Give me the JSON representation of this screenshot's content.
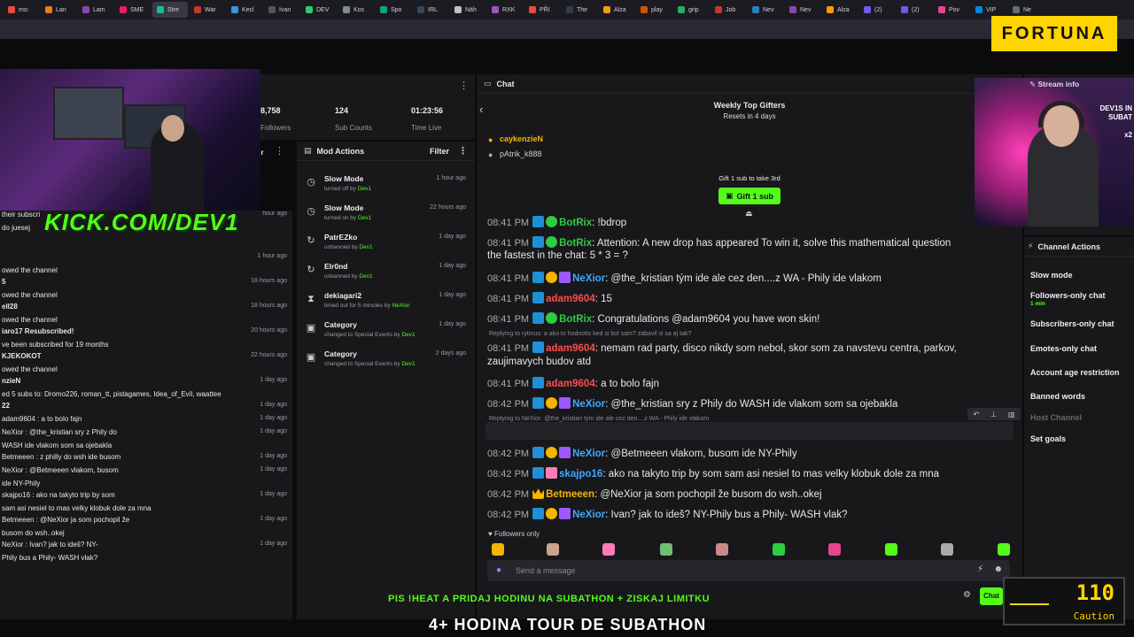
{
  "browser": {
    "tabs": [
      "mo:",
      "Lan",
      "Lam",
      "SME",
      "Stre",
      "War",
      "Kecl",
      "Ivan",
      "DEV",
      "Kos",
      "Spo",
      "IRL",
      "Náh",
      "RXK",
      "PŘI",
      "The",
      "Alza",
      "play",
      "grip",
      "Job",
      "Nev",
      "Nev",
      "Alza",
      "(2)",
      "(2)",
      "Pov",
      "VIP",
      "Ne"
    ]
  },
  "sponsor": "FORTUNA",
  "stream": {
    "overlay_logo": "KICK.COM/DEV1",
    "followers_value": "8,758",
    "followers_label": "Followers",
    "subs_value": "124",
    "subs_label": "Sub Counts",
    "time_value": "01:23:56",
    "time_label": "Time Live"
  },
  "left_feed": [
    {
      "text": "their subscri",
      "time": "hour ago"
    },
    {
      "text": "do juesej",
      "time": ""
    },
    {
      "text": "",
      "time": "1 hour ago"
    },
    {
      "text": "owed the channel",
      "time": ""
    },
    {
      "text": "5",
      "time": "18 hours ago"
    },
    {
      "text": "owed the channel",
      "time": ""
    },
    {
      "text": "ell28",
      "time": "18 hours ago"
    },
    {
      "text": "owed the channel",
      "time": ""
    },
    {
      "text": "iaro17 Resubscribed!",
      "time": "20 hours ago"
    },
    {
      "text": "ve been subscribed for 19 months",
      "time": ""
    },
    {
      "text": "KJEKOKOT",
      "time": "22 hours ago"
    },
    {
      "text": "owed the channel",
      "time": ""
    },
    {
      "text": "nzieN",
      "time": "1 day ago"
    },
    {
      "text": "ed 5 subs to: Dromo226, roman_tt, pistagames, Idea_of_Evil, waattee",
      "time": ""
    },
    {
      "text": "22",
      "time": "1 day ago"
    },
    {
      "text": "adam9604 : a to bolo fajn",
      "time": "1 day ago"
    },
    {
      "text": "NeXior : @the_kristian sry z Phily do",
      "time": "1 day ago"
    },
    {
      "text": "WASH ide vlakom  som sa ojebakla",
      "time": ""
    },
    {
      "text": "Betmeeen : z philly do wsh ide busom",
      "time": "1 day ago"
    },
    {
      "text": "NeXior : @Betmeeen vlakom, busom",
      "time": "1 day ago"
    },
    {
      "text": "ide NY-Phily",
      "time": ""
    },
    {
      "text": "skajpo16 : ako na takyto trip by som",
      "time": "1 day ago"
    },
    {
      "text": "sam asi nesiel to mas velky klobuk dole za mna",
      "time": ""
    },
    {
      "text": "Betmeeen : @NeXior ja som pochopil že",
      "time": "1 day ago"
    },
    {
      "text": "busom do wsh..okej",
      "time": ""
    },
    {
      "text": "NeXior : Ivan?  jak to ideš? NY-",
      "time": "1 day ago"
    },
    {
      "text": "Phily bus a Phily- WASH vlak?",
      "time": ""
    }
  ],
  "mod_actions": {
    "title": "Mod Actions",
    "filter": "Filter",
    "items": [
      {
        "title": "Slow Mode",
        "sub": "turned off by",
        "who": "Dev1",
        "time": "1 hour ago",
        "icon": "slow-mode-icon"
      },
      {
        "title": "Slow Mode",
        "sub": "turned on by",
        "who": "Dev1",
        "time": "22 hours ago",
        "icon": "slow-mode-icon"
      },
      {
        "title": "PatrEZko",
        "sub": "unbanned by",
        "who": "Dev1",
        "time": "1 day ago",
        "icon": "unban-icon"
      },
      {
        "title": "Elr0nd",
        "sub": "unbanned by",
        "who": "Dev1",
        "time": "1 day ago",
        "icon": "unban-icon"
      },
      {
        "title": "dekiagari2",
        "sub": "timed out for 5 minutes by",
        "who": "NeXior",
        "time": "1 day ago",
        "icon": "timeout-icon"
      },
      {
        "title": "Category",
        "sub": "changed to Special Events by",
        "who": "Dev1",
        "time": "1 day ago",
        "icon": "category-icon"
      },
      {
        "title": "Category",
        "sub": "changed to Special Events by",
        "who": "Dev1",
        "time": "2 days ago",
        "icon": "category-icon"
      }
    ]
  },
  "chat": {
    "title": "Chat",
    "gifters_title": "Weekly Top Gifters",
    "gifters_reset": "Resets in 4 days",
    "gifters": [
      "caykenzieN",
      "pAtrik_k888"
    ],
    "gift_prompt": "Gift 1 sub to take 3rd",
    "gift_button": "Gift 1 sub",
    "messages": [
      {
        "ts": "08:41 PM",
        "user": "BotRix",
        "color": "#2ecc40",
        "text": ": !bdrop"
      },
      {
        "ts": "08:41 PM",
        "user": "BotRix",
        "color": "#2ecc40",
        "text": ": Attention: A new drop has appeared  To win it, solve this mathematical question"
      },
      {
        "ts": "",
        "user": "",
        "color": "",
        "text": "the fastest in the chat: 5 * 3 = ?"
      },
      {
        "ts": "08:41 PM",
        "user": "NeXior",
        "color": "#3fa9ff",
        "text": ": @the_kristian tým ide ale cez den....z WA - Phily ide vlakom"
      },
      {
        "ts": "08:41 PM",
        "user": "adam9604",
        "color": "#ff4b4b",
        "text": ": 15"
      },
      {
        "ts": "08:41 PM",
        "user": "BotRix",
        "color": "#2ecc40",
        "text": ": Congratulations @adam9604 you have won skin!"
      },
      {
        "ts": "08:41 PM",
        "user": "adam9604",
        "color": "#ff4b4b",
        "text": ": nemam rad party, disco nikdy som nebol, skor som za navstevu centra, parkov,"
      },
      {
        "ts": "",
        "user": "",
        "color": "",
        "text": "zaujimavych budov atd"
      },
      {
        "ts": "08:41 PM",
        "user": "adam9604",
        "color": "#ff4b4b",
        "text": ": a to bolo fajn"
      },
      {
        "ts": "08:42 PM",
        "user": "NeXior",
        "color": "#3fa9ff",
        "text": ": @the_kristian sry z Phily do WASH ide vlakom  som sa ojebakla"
      },
      {
        "ts": "08:42 PM",
        "user": "Betmeeen",
        "color": "#f4b400",
        "text": ": z philly do wsh ide busom"
      },
      {
        "ts": "08:42 PM",
        "user": "NeXior",
        "color": "#3fa9ff",
        "text": ": @Betmeeen vlakom, busom ide NY-Phily"
      },
      {
        "ts": "08:42 PM",
        "user": "skajpo16",
        "color": "#3fa9ff",
        "text": ": ako na takyto trip by som sam asi nesiel to mas velky klobuk dole za mna"
      },
      {
        "ts": "08:42 PM",
        "user": "Betmeeen",
        "color": "#f4b400",
        "text": ": @NeXior ja som pochopil že busom do wsh..okej"
      },
      {
        "ts": "08:42 PM",
        "user": "NeXior",
        "color": "#3fa9ff",
        "text": ": Ivan?  jak to ideš? NY-Phily bus a Phily- WASH vlak?"
      }
    ],
    "reply1": "Replying to rytmus: a ako to hodnotis ked si bol sam? zabavil si sa aj tak?",
    "reply2": "Replying to NeXior: @the_kristian tým ide ale cez den....z WA - Phily ide vlakom",
    "followers_only": "Followers only",
    "placeholder": "Send a message",
    "send_label": "Chat"
  },
  "stream_info": {
    "title": "Stream info",
    "overlay": "DEV1S IN",
    "overlay2": "SUBAT",
    "count": "x2"
  },
  "channel_actions": {
    "title": "Channel Actions",
    "items": [
      "Slow mode",
      "Followers-only chat",
      "Subscribers-only chat",
      "Emotes-only chat",
      "Account age restriction",
      "Banned words",
      "Host Channel",
      "Set goals"
    ],
    "followers_sub": "1 min"
  },
  "overlay": {
    "banner": "PIS !HEAT A PRIDAJ HODINU NA SUBATHON + ZISKAJ LIMITKU",
    "tour": "4+ HODINA TOUR DE SUBATHON",
    "timer_value": "110",
    "timer_label": "Caution"
  },
  "colors": {
    "accent": "#53fc18",
    "sponsor": "#ffd400",
    "panel": "#18181b"
  }
}
